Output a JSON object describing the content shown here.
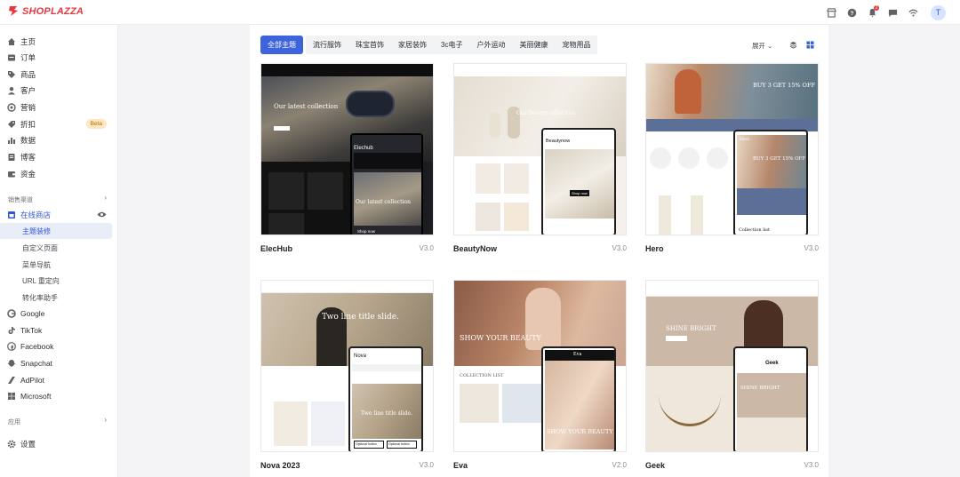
{
  "brand": {
    "name": "SHOPLAZZA",
    "color": "#e8373f"
  },
  "topbar": {
    "icons": [
      "store-icon",
      "help-icon",
      "bell-icon",
      "message-icon",
      "wifi-icon"
    ],
    "notification_count": "2",
    "avatar_initial": "T"
  },
  "sidebar": {
    "items": [
      {
        "label": "主页",
        "icon": "home-icon"
      },
      {
        "label": "订单",
        "icon": "order-icon"
      },
      {
        "label": "商品",
        "icon": "tag-icon"
      },
      {
        "label": "客户",
        "icon": "user-icon"
      },
      {
        "label": "营销",
        "icon": "marketing-icon"
      },
      {
        "label": "折扣",
        "icon": "discount-icon",
        "badge": "Beta"
      },
      {
        "label": "数据",
        "icon": "chart-icon"
      },
      {
        "label": "博客",
        "icon": "blog-icon"
      },
      {
        "label": "资金",
        "icon": "wallet-icon"
      }
    ],
    "sales_channels_label": "销售渠道",
    "online_store_label": "在线商店",
    "online_store_sub": [
      "主题装修",
      "自定义页面",
      "菜单导航",
      "URL 重定向",
      "转化率助手"
    ],
    "channels": [
      {
        "label": "Google",
        "icon": "google-icon"
      },
      {
        "label": "TikTok",
        "icon": "tiktok-icon"
      },
      {
        "label": "Facebook",
        "icon": "facebook-icon"
      },
      {
        "label": "Snapchat",
        "icon": "snapchat-icon"
      },
      {
        "label": "AdPilot",
        "icon": "adpilot-icon"
      },
      {
        "label": "Microsoft",
        "icon": "microsoft-icon"
      }
    ],
    "apps_label": "应用",
    "settings_label": "设置"
  },
  "filters": {
    "tabs": [
      "全部主题",
      "流行服饰",
      "珠宝首饰",
      "家居装饰",
      "3c电子",
      "户外运动",
      "美丽健康",
      "宠物用品"
    ],
    "active_tab": "全部主题",
    "expand_label": "展开"
  },
  "themes": [
    {
      "name": "ElecHub",
      "version": "V3.0",
      "hero": "Our latest collection",
      "sub": "Our latest collection",
      "cta": "Shop now",
      "mobile_title": "Elechub"
    },
    {
      "name": "BeautyNow",
      "version": "V3.0",
      "hero": "Our Beauty collection",
      "cta": "Shop now",
      "mobile_title": "Beautynow"
    },
    {
      "name": "Hero",
      "version": "V3.0",
      "hero": "BUY 3 GET 15% OFF",
      "sub": "BUY 3 GET 15% OFF",
      "section": "Collection list",
      "mobile_title": "Hero"
    },
    {
      "name": "Nova 2023",
      "version": "V3.0",
      "hero": "Two line title slide.",
      "sub": "Two line title slide.",
      "cta1": "Optional button",
      "cta2": "Optional button",
      "mobile_title": "Nova"
    },
    {
      "name": "Eva",
      "version": "V2.0",
      "hero": "SHOW YOUR BEAUTY",
      "sub": "SHOW YOUR BEAUTY",
      "section": "COLLECTION LIST",
      "mobile_title": "Eva"
    },
    {
      "name": "Geek",
      "version": "V3.0",
      "hero": "SHINE BRIGHT",
      "sub": "SHINE BRIGHT",
      "mobile_title": "Geek"
    }
  ]
}
